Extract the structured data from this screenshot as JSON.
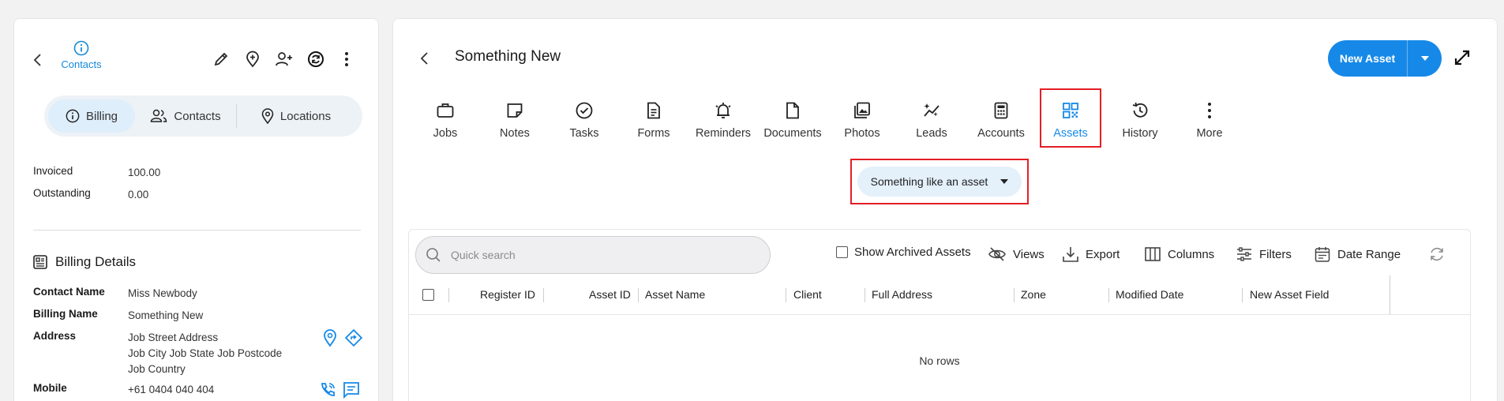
{
  "left_panel": {
    "contacts_label": "Contacts",
    "segments": [
      {
        "label": "Billing",
        "icon": "info-circle-icon",
        "active": true
      },
      {
        "label": "Contacts",
        "icon": "users-icon",
        "active": false
      },
      {
        "label": "Locations",
        "icon": "map-pin-icon",
        "active": false
      }
    ],
    "summary": [
      {
        "key": "Invoiced",
        "value": "100.00"
      },
      {
        "key": "Outstanding",
        "value": "0.00"
      }
    ],
    "billing_details_title": "Billing Details",
    "details": {
      "contact_name": {
        "key": "Contact Name",
        "value": "Miss Newbody"
      },
      "billing_name": {
        "key": "Billing Name",
        "value": "Something New"
      },
      "address": {
        "key": "Address",
        "line1": "Job Street Address",
        "line2": "Job City Job State Job Postcode",
        "line3": "Job Country"
      },
      "mobile": {
        "key": "Mobile",
        "value": "+61 0404 040 404"
      }
    }
  },
  "right_panel": {
    "title": "Something New",
    "new_asset_label": "New Asset",
    "tabs": [
      {
        "label": "Jobs",
        "icon": "briefcase-icon"
      },
      {
        "label": "Notes",
        "icon": "note-icon"
      },
      {
        "label": "Tasks",
        "icon": "check-circle-icon"
      },
      {
        "label": "Forms",
        "icon": "form-icon"
      },
      {
        "label": "Reminders",
        "icon": "alarm-icon"
      },
      {
        "label": "Documents",
        "icon": "document-icon"
      },
      {
        "label": "Photos",
        "icon": "photos-icon"
      },
      {
        "label": "Leads",
        "icon": "leads-icon"
      },
      {
        "label": "Accounts",
        "icon": "calculator-icon"
      },
      {
        "label": "Assets",
        "icon": "qr-code-icon",
        "active": true
      },
      {
        "label": "History",
        "icon": "history-icon"
      },
      {
        "label": "More",
        "icon": "more-vertical-icon"
      }
    ],
    "asset_type_selected": "Something like an asset",
    "grid": {
      "search_placeholder": "Quick search",
      "show_archived_label": "Show Archived Assets",
      "views_label": "Views",
      "export_label": "Export",
      "columns_label": "Columns",
      "filters_label": "Filters",
      "date_range_label": "Date Range",
      "columns": [
        "Register ID",
        "Asset ID",
        "Asset Name",
        "Client",
        "Full Address",
        "Zone",
        "Modified Date",
        "New Asset Field"
      ],
      "empty_text": "No rows"
    }
  },
  "colors": {
    "accent": "#1689e8",
    "highlight": "#e41e26"
  }
}
